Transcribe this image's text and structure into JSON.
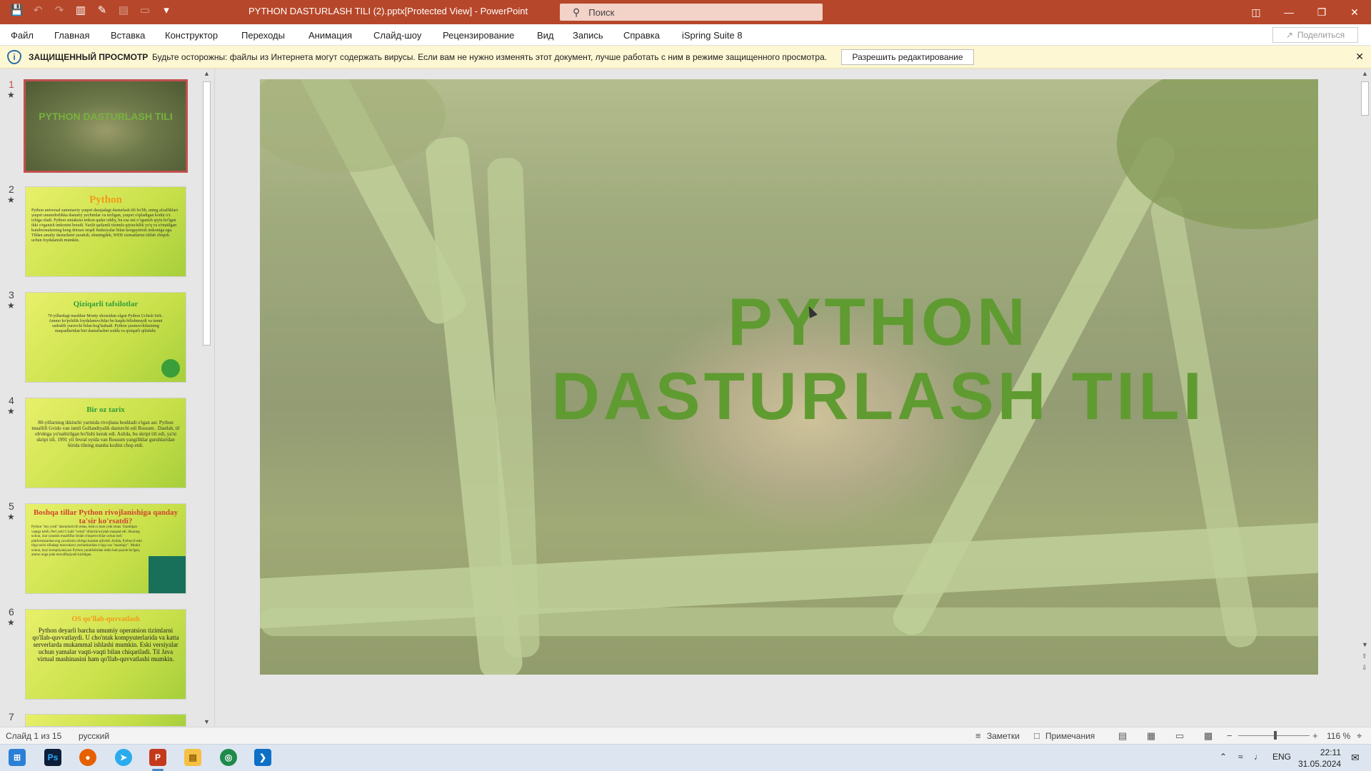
{
  "window": {
    "title": "PYTHON DASTURLASH TILI (2).pptx[Protected View]  -  PowerPoint",
    "search_placeholder": "Поиск"
  },
  "menu": {
    "items": [
      "Файл",
      "Главная",
      "Вставка",
      "Конструктор",
      "Переходы",
      "Анимация",
      "Слайд-шоу",
      "Рецензирование",
      "Вид",
      "Запись",
      "Справка",
      "iSpring Suite 8"
    ],
    "share_label": "Поделиться"
  },
  "protected_view": {
    "title": "ЗАЩИЩЕННЫЙ ПРОСМОТР",
    "message": "Будьте осторожны: файлы из Интернета могут содержать вирусы. Если вам не нужно изменять этот документ, лучше работать с ним в режиме защищенного просмотра.",
    "enable_button": "Разрешить редактирование"
  },
  "thumbnails": [
    {
      "num": "1",
      "star": "★",
      "title": "PYTHON DASTURLASH TILI"
    },
    {
      "num": "2",
      "star": "★",
      "title": "Python",
      "body": "Python universal zamonaviy yuqori darajadagi dasturlash tili bo'lib, uning afzalliklari yuqori unumdorlikka dasturiy yechimlar va tezligan, yuqori o'qiladigan kodni o'z ichiga oladi. Python sintaksisi imkon qadar oddiy, bu esa uni oʻrganish qiyin bo'lgan ikki o'rganish imkonini beradi. Yaxlit qatlamli tizimda qiyinchilik yo'q va u'rnatilgan kutubxonalarning keng doirasi orqali funksiyalar bilan kengaytirish imkoniga ega. Tildan amaliy dasturlarni yaratish, shuningdek, WEB xizmatlarini ishlab chiqish uchun foydalanish mumkin."
    },
    {
      "num": "3",
      "star": "★",
      "title": "Qiziqarli tafsilotlar",
      "body": "70-yillardagi mashhur Monty shousidan olgan Python Uchish Sirk . Ammo ko'pchilik foydalanuvchilar bu haqda bilishmaydi va ismni sudralib yuruvchi bilan bog'lashadi. Python yaratuvchilarining maqsadlaridan biri dasturlashni sodda va qiziqarli qilishdir."
    },
    {
      "num": "4",
      "star": "★",
      "title": "Bir oz tarix",
      "body": "80-yillarning ikkinchi yarmida rivojlana boshladi o'tgan asr. Python muallifi Gvido van ismli Gollandiyalik dasturchi edi Rossum . Dastlab, til ob'ektga yo'naltirilgan bo'lishi kerak edi. Aslida, bu skript tili edi, ya'ni skript tili. 1991 yil fevral oyida van Rossum yangiliklar guruhlaridan birida tilning manba kodini chop etdi."
    },
    {
      "num": "5",
      "star": "★",
      "title": "Boshqa tillar Python rivojlanishiga qanday ta'sir ko'rsatdi?",
      "body": "Python \"itsy yosh\" dasturlash tili emas, lekin u ham yoki emas. Yaratilgan vaqtga kelib, Perl yoki C kabi \"yetuk\" tillarida ko'plab maqsad edi. Shuning uchun, ular yaratish mualliflar ishlab chiqaruvchilar uchun turli platformalardan eng yaxshisini olishga harakat qilishdi. Aslida, Python 8 eski tilga tarixi tilladagi mavzularni yechimlaridan o'ziga xos \"mantiqiy\". Modul uchun, boyi kompilyatsiyasi Python yaratilishidan oldin ham paydo bo'lgan, ammo unga juda muvaffaqiyatli kiritilgan."
    },
    {
      "num": "6",
      "star": "★",
      "title": "OS qo'llab-quvvatlash",
      "body": "Python deyarli barcha umumiy operatsion tizimlarni qo'llab-quvvatlaydi. U cho'ntak kompyuterlarida va katta serverlarda mukammal ishlashi mumkin. Eski versiyalar uchun yamalar vaqti-vaqti bilan chiqariladi. Til Java virtual mashinasini ham qo'llab-quvvatlashi mumkin."
    },
    {
      "num": "7",
      "star": "",
      "title": ""
    }
  ],
  "slide": {
    "title_line1": "PYTHON",
    "title_line2": "DASTURLASH TILI"
  },
  "status": {
    "slide_counter": "Слайд 1 из 15",
    "language": "русский",
    "notes": "Заметки",
    "comments": "Примечания",
    "zoom": "116 %",
    "zoom_level_percent": 116
  },
  "taskbar": {
    "lang": "ENG",
    "time": "22:11",
    "date": "31.05.2024"
  },
  "colors": {
    "accent": "#b7472a",
    "slide_title": "#5f9b31",
    "protected_bar": "#fdf7d3"
  }
}
